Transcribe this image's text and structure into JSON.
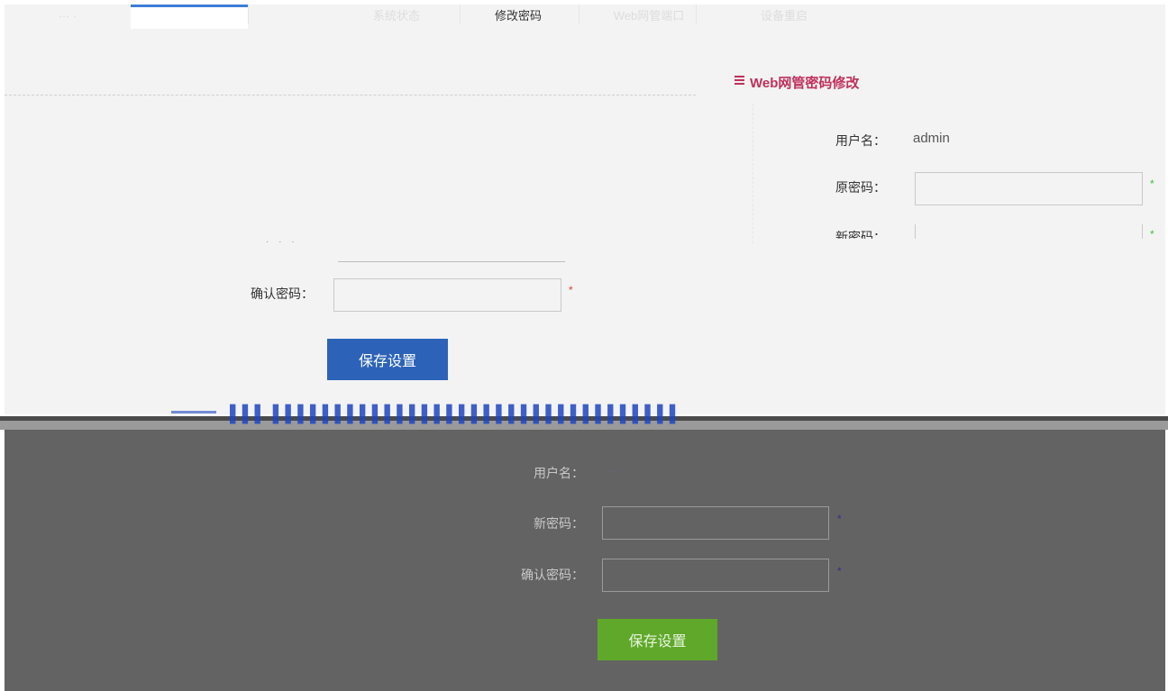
{
  "tabs": [
    {
      "label": "系统状态"
    },
    {
      "label": "修改密码"
    },
    {
      "label": "Web网管端口"
    },
    {
      "label": "设备重启"
    }
  ],
  "section": {
    "title": "Web网管密码修改"
  },
  "top_form": {
    "username_label": "用户名：",
    "username_value": "admin",
    "old_password_label": "原密码：",
    "new_password_label": "新密码：",
    "confirm_label": "确认密码：",
    "required_mark": "*",
    "save_label": "保存设置"
  },
  "bottom_form": {
    "username_label": "用户名：",
    "new_password_label": "新密码：",
    "confirm_label": "确认密码：",
    "required_mark": "*",
    "save_label": "保存设置"
  },
  "colors": {
    "accent_blue": "#2c63b8",
    "title_magenta": "#c0315d",
    "save_green": "#5fa82a",
    "required_green": "#36c536",
    "required_red": "#e03b2b",
    "tab_indicator": "#3d7ed8"
  }
}
